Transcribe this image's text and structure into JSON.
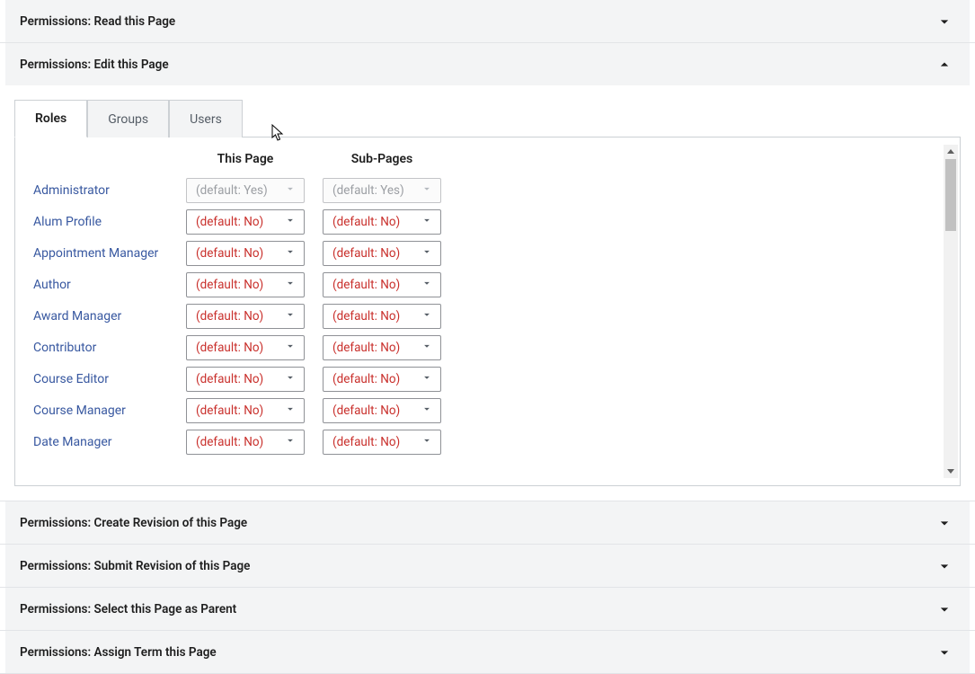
{
  "panels": {
    "read": "Permissions: Read this Page",
    "edit": "Permissions: Edit this Page",
    "create_rev": "Permissions: Create Revision of this Page",
    "submit_rev": "Permissions: Submit Revision of this Page",
    "select_parent": "Permissions: Select this Page as Parent",
    "assign_term": "Permissions: Assign Term this Page"
  },
  "tabs": {
    "roles": "Roles",
    "groups": "Groups",
    "users": "Users"
  },
  "columns": {
    "this_page": "This Page",
    "sub_pages": "Sub-Pages"
  },
  "roles": [
    {
      "name": "Administrator",
      "this_page": "(default: Yes)",
      "sub_pages": "(default: Yes)",
      "style": "yes"
    },
    {
      "name": "Alum Profile",
      "this_page": "(default: No)",
      "sub_pages": "(default: No)",
      "style": "no"
    },
    {
      "name": "Appointment Manager",
      "this_page": "(default: No)",
      "sub_pages": "(default: No)",
      "style": "no"
    },
    {
      "name": "Author",
      "this_page": "(default: No)",
      "sub_pages": "(default: No)",
      "style": "no"
    },
    {
      "name": "Award Manager",
      "this_page": "(default: No)",
      "sub_pages": "(default: No)",
      "style": "no"
    },
    {
      "name": "Contributor",
      "this_page": "(default: No)",
      "sub_pages": "(default: No)",
      "style": "no"
    },
    {
      "name": "Course Editor",
      "this_page": "(default: No)",
      "sub_pages": "(default: No)",
      "style": "no"
    },
    {
      "name": "Course Manager",
      "this_page": "(default: No)",
      "sub_pages": "(default: No)",
      "style": "no"
    },
    {
      "name": "Date Manager",
      "this_page": "(default: No)",
      "sub_pages": "(default: No)",
      "style": "no"
    }
  ]
}
